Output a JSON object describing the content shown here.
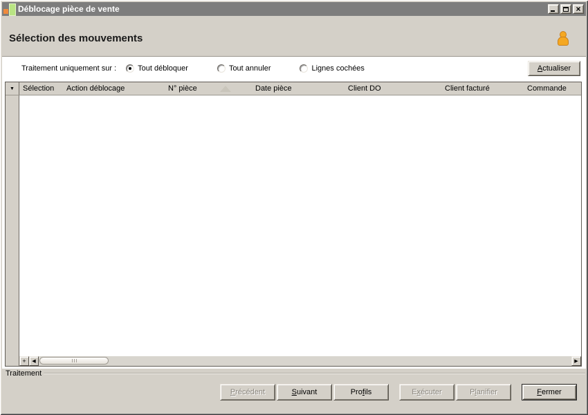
{
  "colors": {
    "titlebar": "#7d7d7d",
    "window_bg": "#d4d0c8",
    "panel_bg": "#ffffff",
    "accent_orange": "#f5a822",
    "title_icon_orange": "#ef8a3c",
    "title_icon_green": "#b9e483"
  },
  "window": {
    "title": "Déblocage pièce de vente",
    "close_glyph": "×"
  },
  "header": {
    "title": "Sélection des mouvements"
  },
  "filter": {
    "label": "Traitement uniquement sur :",
    "options": [
      {
        "label": "Tout débloquer",
        "selected": true
      },
      {
        "label": "Tout annuler",
        "selected": false
      },
      {
        "label": "Lignes cochées",
        "selected": false
      }
    ],
    "refresh": {
      "pre": "",
      "key": "A",
      "post": "ctualiser"
    }
  },
  "table": {
    "selector_glyph": "▼",
    "columns": [
      "Sélection",
      "Action déblocage",
      "N° pièce",
      "Date pièce",
      "Client DO",
      "Client facturé",
      "Commande"
    ],
    "sort": {
      "column": "N° pièce",
      "direction": "ascending"
    },
    "rows": [],
    "scrollbar": {
      "plus_glyph": "+",
      "left_glyph": "◀",
      "right_glyph": "▶"
    }
  },
  "status": {
    "label": "Traitement"
  },
  "footer": {
    "buttons": [
      {
        "pre": "",
        "key": "P",
        "post": "récédent",
        "disabled": true,
        "default": false
      },
      {
        "pre": "",
        "key": "S",
        "post": "uivant",
        "disabled": false,
        "default": false
      },
      {
        "pre": "Pro",
        "key": "f",
        "post": "ils",
        "disabled": false,
        "default": false
      },
      {
        "pre": "E",
        "key": "x",
        "post": "écuter",
        "disabled": true,
        "default": false
      },
      {
        "pre": "P",
        "key": "l",
        "post": "anifier",
        "disabled": true,
        "default": false
      },
      {
        "pre": "",
        "key": "F",
        "post": "ermer",
        "disabled": false,
        "default": true
      }
    ]
  }
}
